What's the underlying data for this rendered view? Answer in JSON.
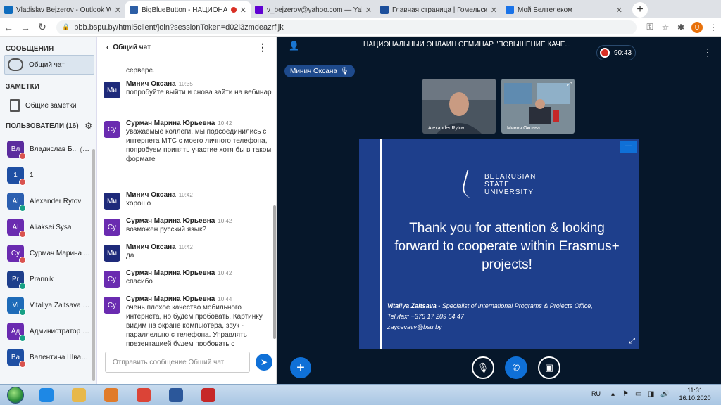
{
  "browser": {
    "tabs": [
      {
        "title": "Vladislav Bejzerov - Outlook We",
        "color": "#0f6cbd",
        "active": false
      },
      {
        "title": "BigBlueButton - НАЦИОНА",
        "color": "#2d5fa6",
        "active": true,
        "recording": true
      },
      {
        "title": "v_bejzerov@yahoo.com — Yaho",
        "color": "#6001d2",
        "active": false
      },
      {
        "title": "Главная страница | Гомельски",
        "color": "#1c4f9c",
        "active": false
      },
      {
        "title": "Мой Белтелеком",
        "color": "#1a73e8",
        "active": false
      }
    ],
    "tab_close": "✕",
    "new_tab": "+",
    "url": "bbb.bspu.by/html5client/join?sessionToken=d02l3zmdeazrfijk",
    "profile_initial": "U"
  },
  "sidebar": {
    "messages_title": "СООБЩЕНИЯ",
    "public_chat": "Общий чат",
    "notes_title": "ЗАМЕТКИ",
    "shared_notes": "Общие заметки",
    "users_title": "ПОЛЬЗОВАТЕЛИ (16)",
    "users": [
      {
        "initials": "Вл",
        "name": "Владислав Б...",
        "you": "(Вы)",
        "color": "#5b2c9e",
        "status": "red"
      },
      {
        "initials": "1",
        "name": "1",
        "you": "",
        "color": "#1e4fa3",
        "status": "red"
      },
      {
        "initials": "Al",
        "name": "Alexander Rytov",
        "you": "",
        "color": "#2b5fb0",
        "status": "grn"
      },
      {
        "initials": "Al",
        "name": "Aliaksei Sysa",
        "you": "",
        "color": "#6a2bb0",
        "status": "red"
      },
      {
        "initials": "Су",
        "name": "Сурмач Марина ...",
        "you": "",
        "color": "#6a2bb0",
        "status": "red"
      },
      {
        "initials": "Pr",
        "name": "Prannik",
        "you": "",
        "color": "#1e3f8c",
        "status": "grn"
      },
      {
        "initials": "Vi",
        "name": "Vitaliya Zaitsava BSU",
        "you": "",
        "color": "#1e6bb8",
        "status": "grn"
      },
      {
        "initials": "Ад",
        "name": "Администратор О...",
        "you": "",
        "color": "#6a2bb0",
        "status": "grn"
      },
      {
        "initials": "Ва",
        "name": "Валентина Швайко",
        "you": "",
        "color": "#1e4fa3",
        "status": "red"
      }
    ]
  },
  "chat": {
    "title": "Общий чат",
    "back": "‹",
    "menu": "⋮",
    "partial_text": "сервере.",
    "messages": [
      {
        "initials": "Ми",
        "name": "Минич Оксана",
        "time": "10:35",
        "text": "попробуйте выйти и снова зайти на вебинар",
        "color": "#1e2a7a"
      },
      {
        "initials": "Су",
        "name": "Сурмач Марина Юрьевна",
        "time": "10:42",
        "text": "уважаемые коллеги, мы подсоединились с интернета МТС с моего личного телефона, попробуем принять участие хотя бы в таком формате",
        "color": "#6a2bb0"
      },
      {
        "initials": "Ми",
        "name": "Минич Оксана",
        "time": "10:42",
        "text": "хорошо",
        "color": "#1e2a7a"
      },
      {
        "initials": "Су",
        "name": "Сурмач Марина Юрьевна",
        "time": "10:42",
        "text": "возможен русский язык?",
        "color": "#6a2bb0"
      },
      {
        "initials": "Ми",
        "name": "Минич Оксана",
        "time": "10:42",
        "text": "да",
        "color": "#1e2a7a"
      },
      {
        "initials": "Су",
        "name": "Сурмач Марина Юрьевна",
        "time": "10:42",
        "text": "спасибо",
        "color": "#6a2bb0"
      },
      {
        "initials": "Су",
        "name": "Сурмач Марина Юрьевна",
        "time": "10:44",
        "text": "очень плохое качество мобильного интернета, но будем пробовать. Картинку видим на экране компьютера, звук - параллельно с телефона. Управлять презентацией будем пробовать с компьютера...",
        "color": "#6a2bb0"
      }
    ],
    "input_placeholder": "Отправить сообщение Общий чат",
    "send_icon": "➤"
  },
  "main": {
    "title": "НАЦИОНАЛЬНЫЙ ОНЛАЙН СЕМИНАР \"ПОВЫШЕНИЕ КАЧЕ...",
    "timer": "90:43",
    "menu": "⋮",
    "talking": "Минич Оксана",
    "videos": [
      {
        "name": "Alexander Rytov"
      },
      {
        "name": "Минич Оксана"
      }
    ],
    "slide": {
      "minimize": "—",
      "logo_line1": "BELARUSIAN",
      "logo_line2": "STATE",
      "logo_line3": "UNIVERSITY",
      "thanks": "Thank you for attention & looking forward to cooperate within Erasmus+ projects!",
      "contact_name": "Vitaliya Zaitsava",
      "contact_role": " - Specialist  of International Programs & Projects Office,",
      "contact_phone": "Tel./fax: +375 17 209 54 47",
      "contact_email": "zaycevavv@bsu.by"
    },
    "actions_icon": "+"
  },
  "taskbar": {
    "lang": "RU",
    "time": "11:31",
    "date": "16.10.2020",
    "apps": [
      {
        "name": "ie",
        "color": "#1e88e5"
      },
      {
        "name": "explorer",
        "color": "#e8b84a"
      },
      {
        "name": "media",
        "color": "#e07b2a"
      },
      {
        "name": "chrome",
        "color": "#db4437"
      },
      {
        "name": "word",
        "color": "#2b579a"
      },
      {
        "name": "pdf",
        "color": "#c62828"
      }
    ]
  }
}
